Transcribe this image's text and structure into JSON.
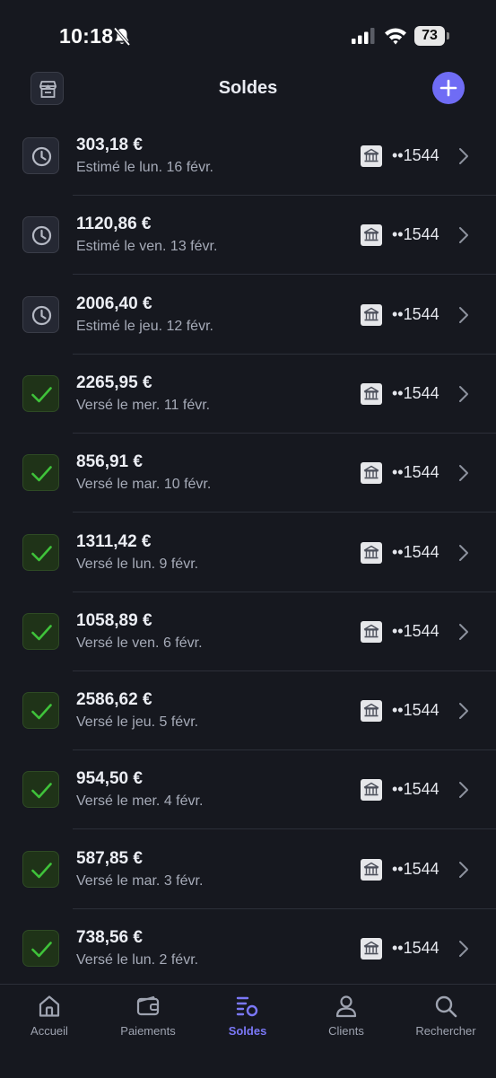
{
  "status_bar": {
    "time": "10:18",
    "battery": "73"
  },
  "header": {
    "title": "Soldes"
  },
  "payouts": [
    {
      "amount": "303,18 €",
      "date": "Estimé le lun. 16 févr.",
      "account": "••1544",
      "status": "pending"
    },
    {
      "amount": "1120,86 €",
      "date": "Estimé le ven. 13 févr.",
      "account": "••1544",
      "status": "pending"
    },
    {
      "amount": "2006,40 €",
      "date": "Estimé le jeu. 12 févr.",
      "account": "••1544",
      "status": "pending"
    },
    {
      "amount": "2265,95 €",
      "date": "Versé le mer. 11 févr.",
      "account": "••1544",
      "status": "paid"
    },
    {
      "amount": "856,91 €",
      "date": "Versé le mar. 10 févr.",
      "account": "••1544",
      "status": "paid"
    },
    {
      "amount": "1311,42 €",
      "date": "Versé le lun. 9 févr.",
      "account": "••1544",
      "status": "paid"
    },
    {
      "amount": "1058,89 €",
      "date": "Versé le ven. 6 févr.",
      "account": "••1544",
      "status": "paid"
    },
    {
      "amount": "2586,62 €",
      "date": "Versé le jeu. 5 févr.",
      "account": "••1544",
      "status": "paid"
    },
    {
      "amount": "954,50 €",
      "date": "Versé le mer. 4 févr.",
      "account": "••1544",
      "status": "paid"
    },
    {
      "amount": "587,85 €",
      "date": "Versé le mar. 3 févr.",
      "account": "••1544",
      "status": "paid"
    },
    {
      "amount": "738,56 €",
      "date": "Versé le lun. 2 févr.",
      "account": "••1544",
      "status": "paid"
    }
  ],
  "tabs": [
    {
      "label": "Accueil",
      "icon": "home-icon"
    },
    {
      "label": "Paiements",
      "icon": "wallet-icon"
    },
    {
      "label": "Soldes",
      "icon": "balances-icon",
      "active": true
    },
    {
      "label": "Clients",
      "icon": "person-icon"
    },
    {
      "label": "Rechercher",
      "icon": "search-icon"
    }
  ],
  "colors": {
    "background": "#16181f",
    "accent": "#6f6cf5",
    "success": "#3fc23a"
  }
}
